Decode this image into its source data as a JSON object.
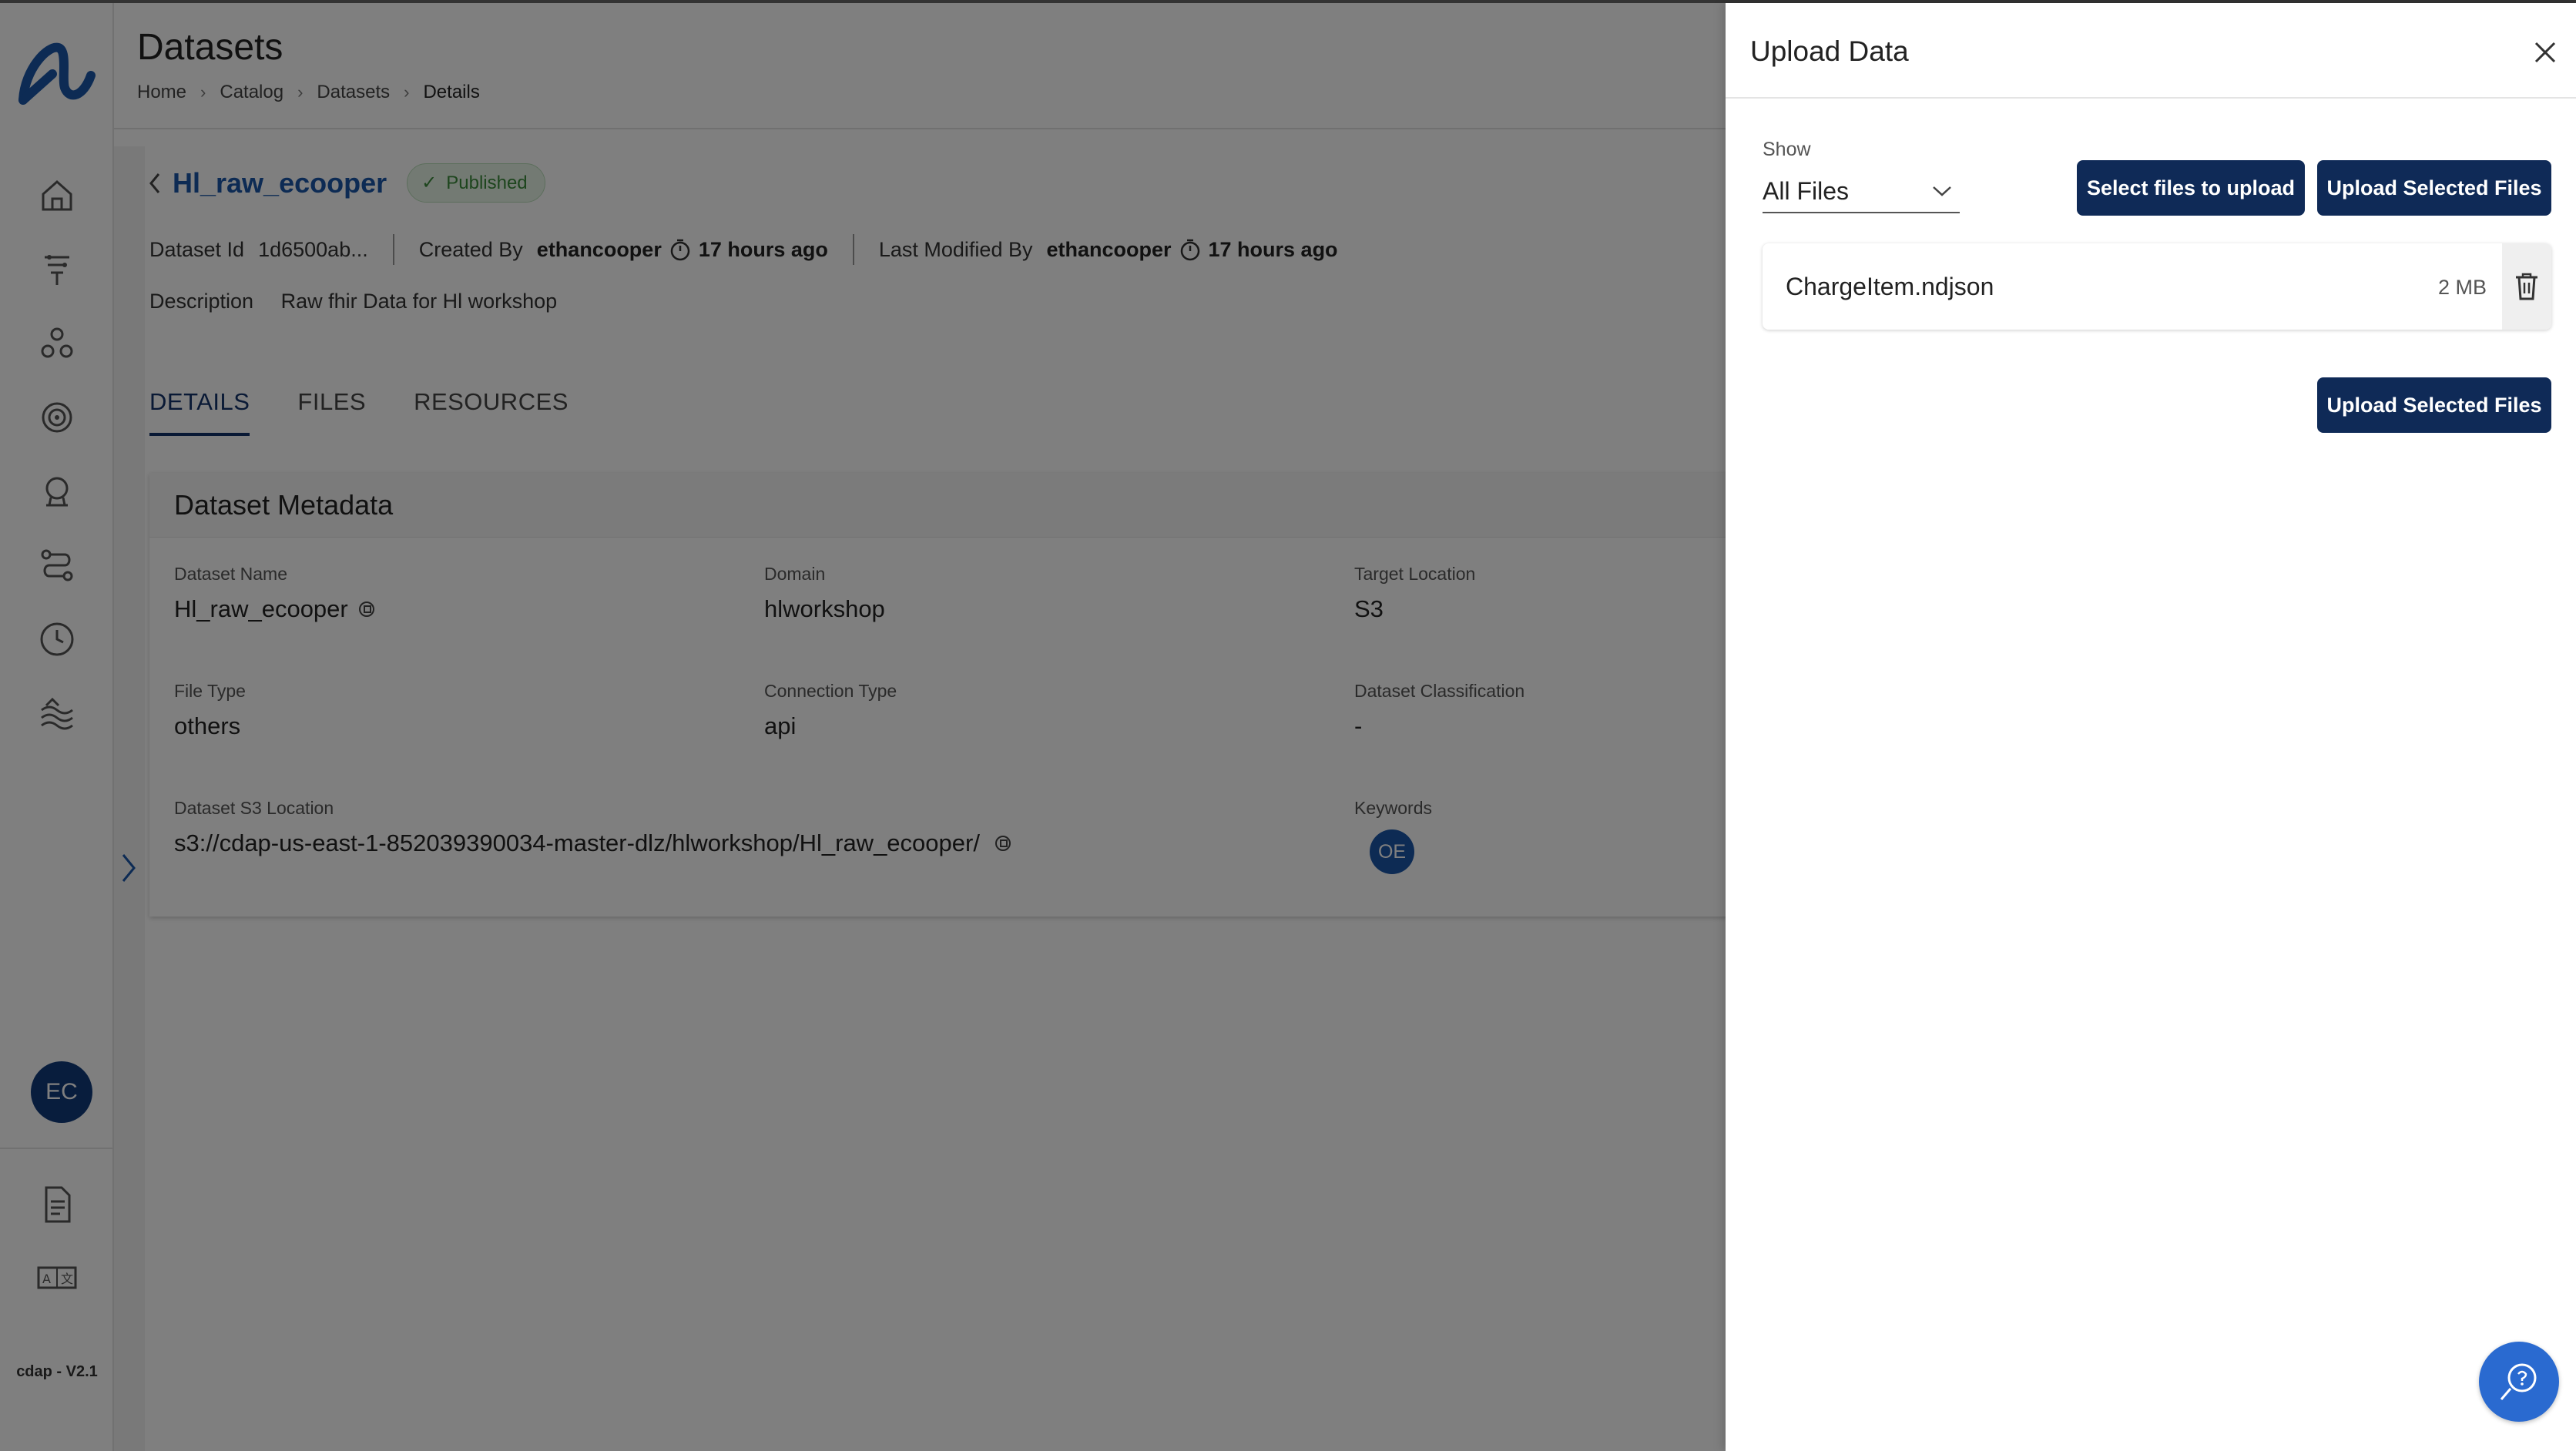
{
  "app": {
    "version": "cdap - V2.1",
    "user_initials": "EC"
  },
  "header": {
    "title": "Datasets",
    "breadcrumb": [
      "Home",
      "Catalog",
      "Datasets",
      "Details"
    ]
  },
  "sidebar": {
    "icons": [
      "home-icon",
      "funnel-icon",
      "nodes-icon",
      "target-icon",
      "badge-icon",
      "route-icon",
      "clock-icon",
      "water-icon"
    ],
    "bottom_icons": [
      "document-icon",
      "translate-icon"
    ]
  },
  "dataset": {
    "name": "Hl_raw_ecooper",
    "status": "Published",
    "id_label": "Dataset Id",
    "id_value": "1d6500ab...",
    "created_by_label": "Created By",
    "created_by": "ethancooper",
    "created_time": "17 hours ago",
    "modified_by_label": "Last Modified By",
    "modified_by": "ethancooper",
    "modified_time": "17 hours ago",
    "description_label": "Description",
    "description": "Raw fhir Data for Hl workshop"
  },
  "tabs": [
    {
      "label": "DETAILS",
      "active": true
    },
    {
      "label": "FILES",
      "active": false
    },
    {
      "label": "RESOURCES",
      "active": false
    }
  ],
  "metadata": {
    "title": "Dataset Metadata",
    "dataset_name_label": "Dataset Name",
    "dataset_name": "Hl_raw_ecooper",
    "domain_label": "Domain",
    "domain": "hlworkshop",
    "target_location_label": "Target Location",
    "target_location": "S3",
    "file_type_label": "File Type",
    "file_type": "others",
    "connection_type_label": "Connection Type",
    "connection_type": "api",
    "classification_label": "Dataset Classification",
    "classification": "-",
    "s3_location_label": "Dataset S3 Location",
    "s3_location": "s3://cdap-us-east-1-852039390034-master-dlz/hlworkshop/Hl_raw_ecooper/",
    "keywords_label": "Keywords",
    "keywords": [
      "OE"
    ]
  },
  "drawer": {
    "title": "Upload Data",
    "show_label": "Show",
    "show_value": "All Files",
    "select_button": "Select files to upload",
    "upload_button": "Upload Selected Files",
    "files": [
      {
        "name": "ChargeItem.ndjson",
        "size": "2 MB"
      }
    ]
  },
  "colors": {
    "accent": "#0f2a57",
    "link": "#1a56a8",
    "published": "#3a8a3a",
    "help": "#2a6ad0"
  }
}
